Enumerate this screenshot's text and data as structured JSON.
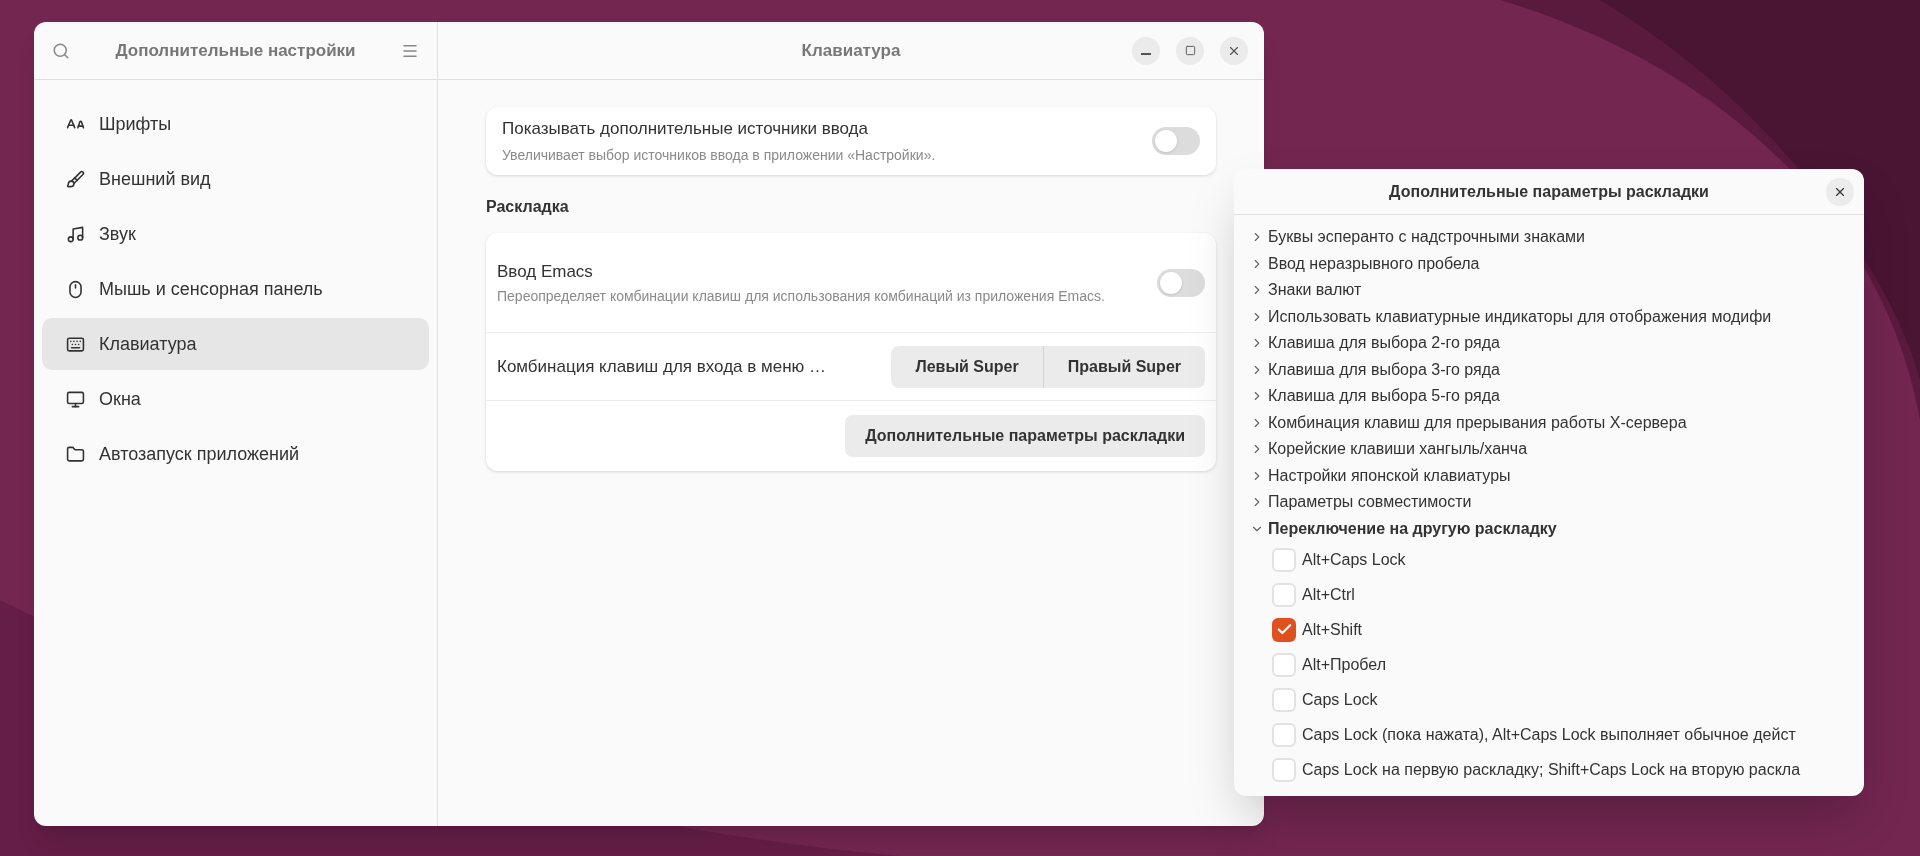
{
  "sidebar": {
    "title": "Дополнительные настройки",
    "items": [
      {
        "label": "Шрифты",
        "kind": "fonts",
        "selected": false
      },
      {
        "label": "Внешний вид",
        "kind": "appearance",
        "selected": false
      },
      {
        "label": "Звук",
        "kind": "sound",
        "selected": false
      },
      {
        "label": "Мышь и сенсорная панель",
        "kind": "mouse",
        "selected": false
      },
      {
        "label": "Клавиатура",
        "kind": "keyboard",
        "selected": true
      },
      {
        "label": "Окна",
        "kind": "windows",
        "selected": false
      },
      {
        "label": "Автозапуск приложений",
        "kind": "startup",
        "selected": false
      }
    ]
  },
  "page": {
    "title": "Клавиатура",
    "input_sources": {
      "label": "Показывать дополнительные источники ввода",
      "description": "Увеличивает выбор источников ввода в приложении «Настройки».",
      "on": false
    },
    "section": "Раскладка",
    "emacs": {
      "label": "Ввод Emacs",
      "description": "Переопределяет комбинации клавиш для использования комбинаций из приложения Emacs.",
      "on": false
    },
    "menu_shortcut": {
      "label": "Комбинация клавиш для входа в меню …",
      "options": [
        {
          "label": "Левый Super",
          "selected": false
        },
        {
          "label": "Правый Super",
          "selected": false
        }
      ]
    },
    "layout_button": "Дополнительные параметры раскладки"
  },
  "dialog": {
    "title": "Дополнительные параметры раскладки",
    "groups": [
      {
        "label": "Буквы эсперанто с надстрочными знаками",
        "expanded": false
      },
      {
        "label": "Ввод неразрывного пробела",
        "expanded": false
      },
      {
        "label": "Знаки валют",
        "expanded": false
      },
      {
        "label": "Использовать клавиатурные индикаторы для отображения модифи",
        "expanded": false
      },
      {
        "label": "Клавиша для выбора 2-го ряда",
        "expanded": false
      },
      {
        "label": "Клавиша для выбора 3-го ряда",
        "expanded": false
      },
      {
        "label": "Клавиша для выбора 5-го ряда",
        "expanded": false
      },
      {
        "label": "Комбинация клавиш для прерывания работы X-сервера",
        "expanded": false
      },
      {
        "label": "Корейские клавиши хангыль/ханча",
        "expanded": false
      },
      {
        "label": "Настройки японской клавиатуры",
        "expanded": false
      },
      {
        "label": "Параметры совместимости",
        "expanded": false
      },
      {
        "label": "Переключение на другую раскладку",
        "expanded": true,
        "options": [
          {
            "label": "Alt+Caps Lock",
            "checked": false
          },
          {
            "label": "Alt+Ctrl",
            "checked": false
          },
          {
            "label": "Alt+Shift",
            "checked": true
          },
          {
            "label": "Alt+Пробел",
            "checked": false
          },
          {
            "label": "Caps Lock",
            "checked": false
          },
          {
            "label": "Caps Lock (пока нажата), Alt+Caps Lock выполняет обычное дейст",
            "checked": false
          },
          {
            "label": "Caps Lock на первую раскладку; Shift+Caps Lock на вторую раскла",
            "checked": false
          }
        ]
      }
    ]
  }
}
